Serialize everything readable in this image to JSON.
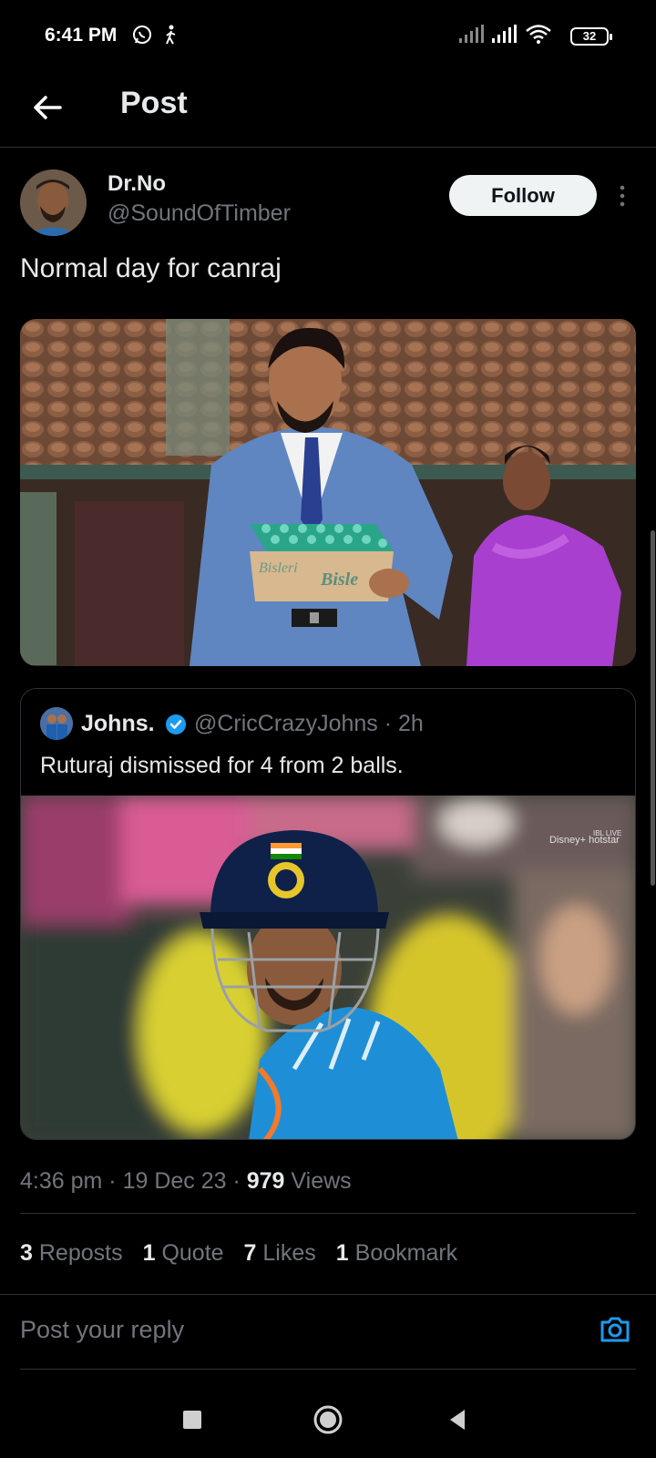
{
  "status_bar": {
    "time": "6:41 PM",
    "battery": "32",
    "icons": [
      "whatsapp-icon",
      "walking-icon",
      "signal-icon",
      "signal-icon",
      "wifi-icon",
      "battery-icon"
    ]
  },
  "header": {
    "title": "Post",
    "back_icon": "arrow-left-icon"
  },
  "post": {
    "author_name": "Dr.No",
    "author_handle": "@SoundOfTimber",
    "follow_label": "Follow",
    "more_icon": "vertical-dots-icon",
    "text": "Normal day for canraj",
    "media_label": "Bisleri"
  },
  "quote": {
    "name": "Johns.",
    "handle_time": "@CricCrazyJohns · 2h",
    "text": "Ruturaj dismissed for 4 from 2 balls.",
    "broadcast_logo": "Disney+ hotstar",
    "broadcast_tag": "IBL LIVE"
  },
  "meta": {
    "time": "4:36 pm",
    "date": "19 Dec 23",
    "views_count": "979",
    "views_label": "Views"
  },
  "stats": [
    {
      "count": "3",
      "label": "Reposts"
    },
    {
      "count": "1",
      "label": "Quote"
    },
    {
      "count": "7",
      "label": "Likes"
    },
    {
      "count": "1",
      "label": "Bookmark"
    }
  ],
  "reply": {
    "placeholder": "Post your reply",
    "camera_icon": "camera-icon"
  },
  "nav": {
    "icons": [
      "recent-apps-icon",
      "home-icon",
      "back-icon"
    ]
  },
  "colors": {
    "background": "#000000",
    "text": "#e7e9ea",
    "muted": "#71767b",
    "accent": "#1d9bf0",
    "border": "#2f3336"
  }
}
